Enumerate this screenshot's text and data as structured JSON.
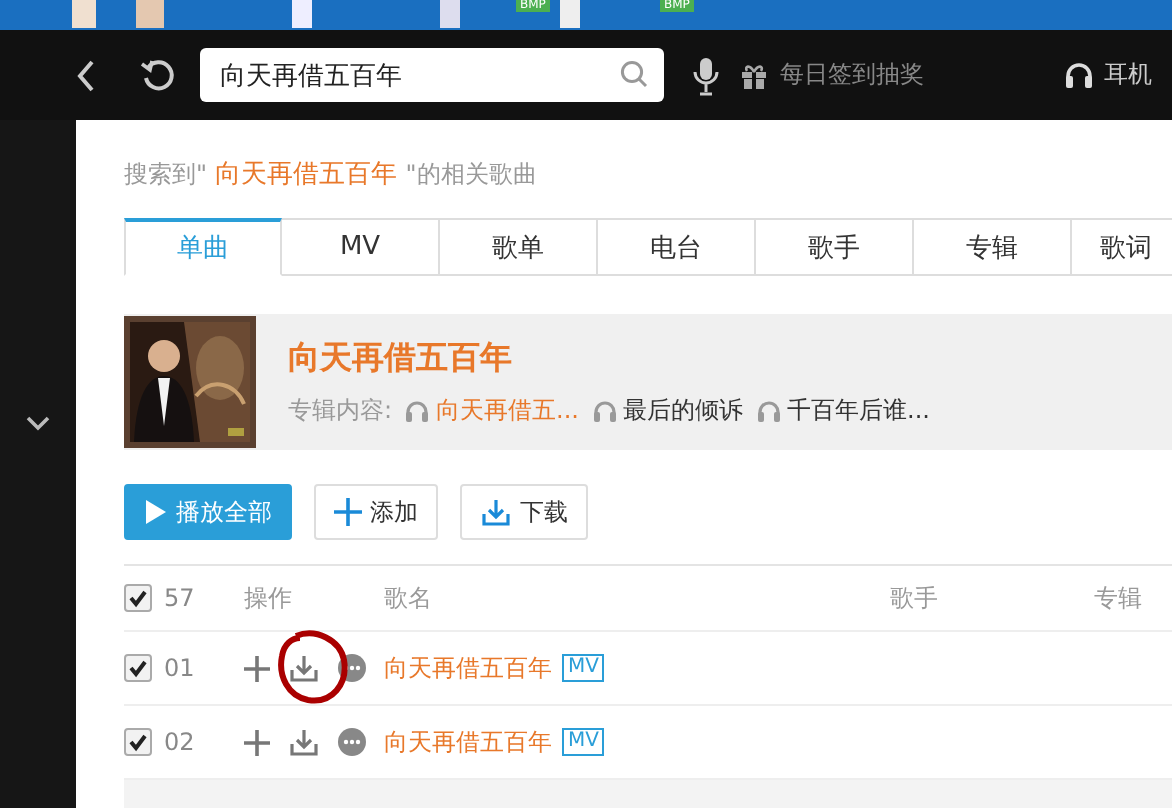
{
  "taskbar": {
    "labels": [
      "BMP",
      "BMP"
    ]
  },
  "toolbar": {
    "search": {
      "value": "向天再借五百年"
    },
    "checkin": "每日签到抽奖",
    "device": "耳机"
  },
  "result_line": {
    "before": "搜索到\"",
    "query": " 向天再借五百年 ",
    "after": "\"的相关歌曲"
  },
  "tabs": [
    {
      "label": "单曲",
      "selected": true
    },
    {
      "label": "MV",
      "selected": false
    },
    {
      "label": "歌单",
      "selected": false
    },
    {
      "label": "电台",
      "selected": false
    },
    {
      "label": "歌手",
      "selected": false
    },
    {
      "label": "专辑",
      "selected": false
    },
    {
      "label": "歌词",
      "selected": false
    }
  ],
  "album": {
    "title": "向天再借五百年",
    "content_label": "专辑内容:",
    "tracks": [
      {
        "title": "向天再借五...",
        "highlight": true
      },
      {
        "title": "最后的倾诉",
        "highlight": false
      },
      {
        "title": "千百年后谁...",
        "highlight": false
      }
    ]
  },
  "actions": [
    {
      "kind": "play",
      "label": "播放全部"
    },
    {
      "kind": "add",
      "label": "添加"
    },
    {
      "kind": "download",
      "label": "下载"
    }
  ],
  "table": {
    "all_checked": true,
    "count": "57",
    "columns": [
      "操作",
      "歌名",
      "歌手",
      "专辑"
    ],
    "rows": [
      {
        "checked": true,
        "number": "01",
        "title": "向天再借五百年",
        "mv": "MV",
        "circled": true
      },
      {
        "checked": true,
        "number": "02",
        "title": "向天再借五百年",
        "mv": "MV",
        "circled": false
      }
    ]
  }
}
